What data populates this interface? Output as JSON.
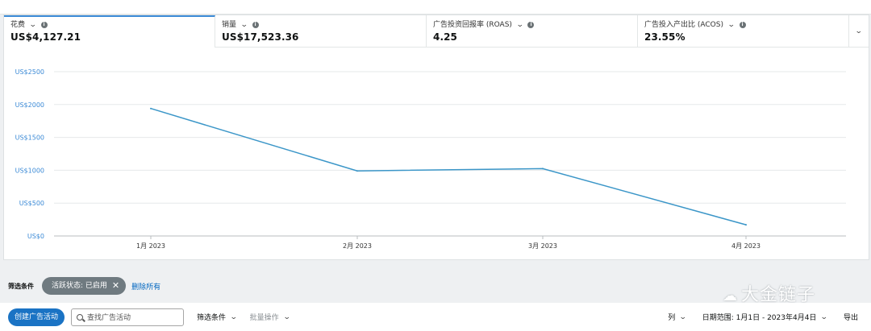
{
  "metrics": [
    {
      "label": "花费",
      "value": "US$4,127.21",
      "active": true
    },
    {
      "label": "销量",
      "value": "US$17,523.36"
    },
    {
      "label": "广告投资回报率 (ROAS)",
      "value": "4.25"
    },
    {
      "label": "广告投入产出比 (ACOS)",
      "value": "23.55%"
    }
  ],
  "icons": {
    "chevron": "chevron-down-icon",
    "info": "info-icon"
  },
  "chart_data": {
    "type": "line",
    "categories": [
      "1月 2023",
      "2月 2023",
      "3月 2023",
      "4月 2023"
    ],
    "series": [
      {
        "values": [
          1940,
          990,
          1025,
          170
        ]
      }
    ],
    "y_ticks": [
      "US$0",
      "US$500",
      "US$1000",
      "US$1500",
      "US$2000",
      "US$2500"
    ],
    "ylim": [
      0,
      2500
    ],
    "grid": true,
    "color": "#3b96c8"
  },
  "filters": {
    "title": "筛选条件",
    "active_filter": "活跃状态: 已启用",
    "clear_all": "删除所有"
  },
  "watermark": "大金链子",
  "toolbar": {
    "create_button": "创建广告活动",
    "search_placeholder": "查找广告活动",
    "filter_dropdown": "筛选条件",
    "bulk_actions": "批量操作",
    "columns": "列",
    "date_range": "日期范围: 1月1日 - 2023年4月4日",
    "export": "导出"
  }
}
